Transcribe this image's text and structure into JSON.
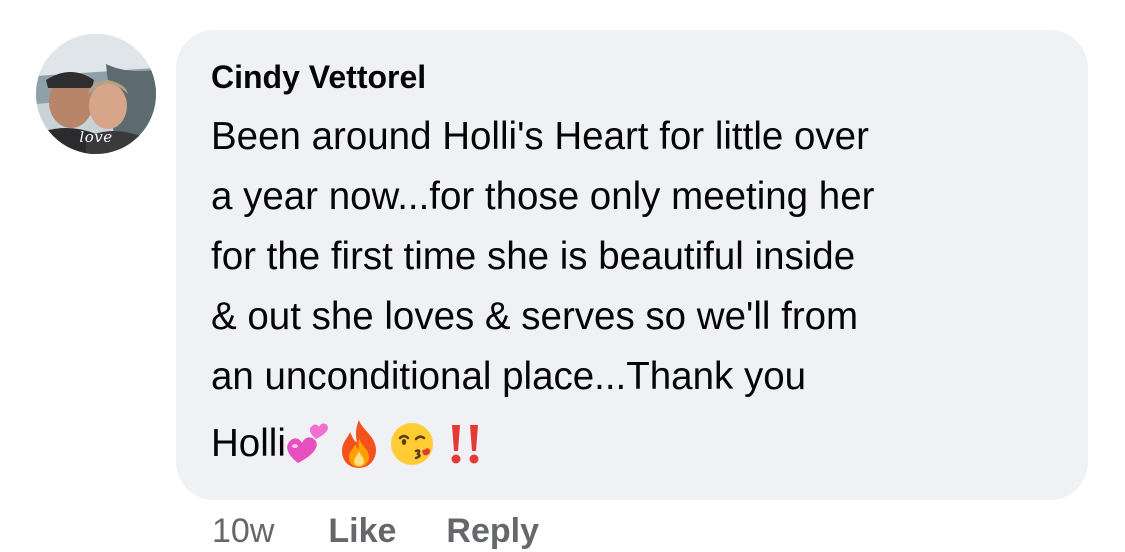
{
  "comment": {
    "author_name": "Cindy Vettorel",
    "avatar": {
      "caption": "love",
      "icon": "profile-photo"
    },
    "text": "Been around Holli's Heart for little over\na year now...for those only meeting her\nfor the first time she is beautiful inside\n& out she loves & serves so we'll from\nan unconditional place...Thank you",
    "text_end": "Holli",
    "emojis": [
      "two-hearts-icon",
      "fire-icon",
      "kissing-face-icon",
      "double-exclamation-icon"
    ]
  },
  "actions": {
    "timestamp": "10w",
    "like_label": "Like",
    "reply_label": "Reply"
  },
  "colors": {
    "bubble": "#f0f1f5",
    "text": "#050505",
    "secondary": "#65676b"
  }
}
